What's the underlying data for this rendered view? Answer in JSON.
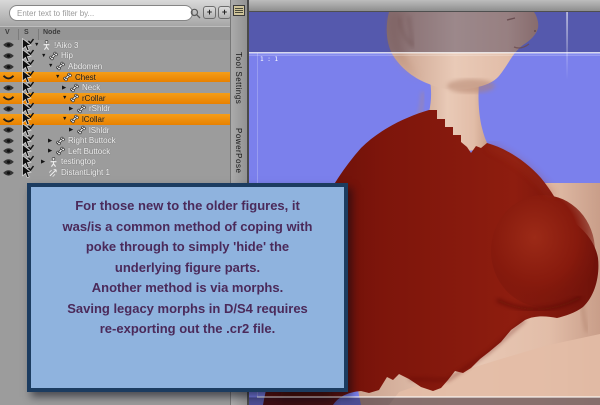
{
  "scene_panel": {
    "filter": {
      "placeholder": "Enter text to filter by...",
      "search_icon": "magnifier",
      "buttons": [
        "+",
        "+"
      ]
    },
    "columns": {
      "visibility": "V",
      "selection": "S",
      "node": "Node"
    },
    "rows": [
      {
        "label": "!Aiko 3",
        "level": 0,
        "arrow": "expanded",
        "icon": "figure",
        "eye": "open",
        "selected": false
      },
      {
        "label": "Hip",
        "level": 1,
        "arrow": "expanded",
        "icon": "bone",
        "eye": "open",
        "selected": false
      },
      {
        "label": "Abdomen",
        "level": 2,
        "arrow": "expanded",
        "icon": "bone",
        "eye": "open",
        "selected": false
      },
      {
        "label": "Chest",
        "level": 3,
        "arrow": "expanded",
        "icon": "bone",
        "eye": "closed",
        "selected": true
      },
      {
        "label": "Neck",
        "level": 4,
        "arrow": "collapsed",
        "icon": "bone",
        "eye": "open",
        "selected": false
      },
      {
        "label": "rCollar",
        "level": 4,
        "arrow": "expanded",
        "icon": "bone",
        "eye": "closed",
        "selected": true
      },
      {
        "label": "rShldr",
        "level": 5,
        "arrow": "collapsed",
        "icon": "bone",
        "eye": "open",
        "selected": false
      },
      {
        "label": "lCollar",
        "level": 4,
        "arrow": "expanded",
        "icon": "bone",
        "eye": "closed",
        "selected": true
      },
      {
        "label": "lShldr",
        "level": 5,
        "arrow": "collapsed",
        "icon": "bone",
        "eye": "open",
        "selected": false
      },
      {
        "label": "Right Buttock",
        "level": 2,
        "arrow": "collapsed",
        "icon": "bone",
        "eye": "open",
        "selected": false
      },
      {
        "label": "Left Buttock",
        "level": 2,
        "arrow": "collapsed",
        "icon": "bone",
        "eye": "open",
        "selected": false
      },
      {
        "label": "testingtop",
        "level": 1,
        "arrow": "collapsed",
        "icon": "figure",
        "eye": "open",
        "selected": false
      },
      {
        "label": "DistantLight 1",
        "level": 1,
        "arrow": "none",
        "icon": "light",
        "eye": "open",
        "selected": false
      }
    ]
  },
  "side_tabs": {
    "panel_menu_icon": "panel-menu",
    "tabs": [
      "Tool Settings",
      "PowerPose"
    ]
  },
  "viewport": {
    "aspect_frame_label": "1 : 1"
  },
  "note_overlay": {
    "lines": [
      "For those new to the older figures, it",
      "was/is a common method of coping with",
      "poke through to simply 'hide' the",
      "underlying figure parts.",
      "Another method is via morphs.",
      "Saving legacy morphs in D/S4 requires",
      "re-exporting out the .cr2 file."
    ]
  },
  "colors": {
    "selection_orange": "#f08a06",
    "viewport_blue": "#7b80ec",
    "viewport_dim_blue": "#565a97",
    "shirt_red": "#8a1a0e",
    "skin": "#e6c3b0",
    "note_bg": "#8fb3de",
    "note_border": "#1c3c60",
    "note_text": "#4b2a5a"
  }
}
